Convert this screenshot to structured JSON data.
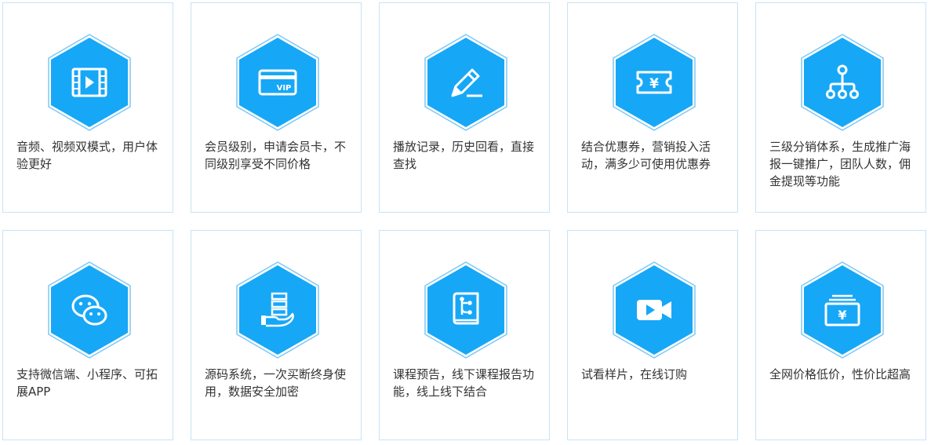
{
  "colors": {
    "hex_fill": "#17a7f7",
    "hex_outline": "#7cc8f5",
    "card_border": "#c7e3f5",
    "text": "#333333"
  },
  "features": [
    {
      "icon": "video-player-icon",
      "text": "音频、视频双模式，用户体验更好"
    },
    {
      "icon": "vip-card-icon",
      "text": "会员级别，申请会员卡，不同级别享受不同价格",
      "icon_label": "VIP"
    },
    {
      "icon": "pencil-edit-icon",
      "text": "播放记录，历史回看，直接查找"
    },
    {
      "icon": "yen-coupon-icon",
      "text": "结合优惠券，营销投入活动，满多少可使用优惠券",
      "icon_label": "¥"
    },
    {
      "icon": "distribution-tree-icon",
      "text": "三级分销体系，生成推广海报一键推广，团队人数，佣金提现等功能"
    },
    {
      "icon": "wechat-icon",
      "text": "支持微信端、小程序、可拓展APP"
    },
    {
      "icon": "server-hand-icon",
      "text": "源码系统，一次买断终身使用，数据安全加密"
    },
    {
      "icon": "course-book-icon",
      "text": "课程预告，线下课程报告功能，线上线下结合"
    },
    {
      "icon": "video-camera-icon",
      "text": "试看样片，在线订购"
    },
    {
      "icon": "yen-wallet-icon",
      "text": "全网价格低价，性价比超高",
      "icon_label": "¥"
    }
  ]
}
